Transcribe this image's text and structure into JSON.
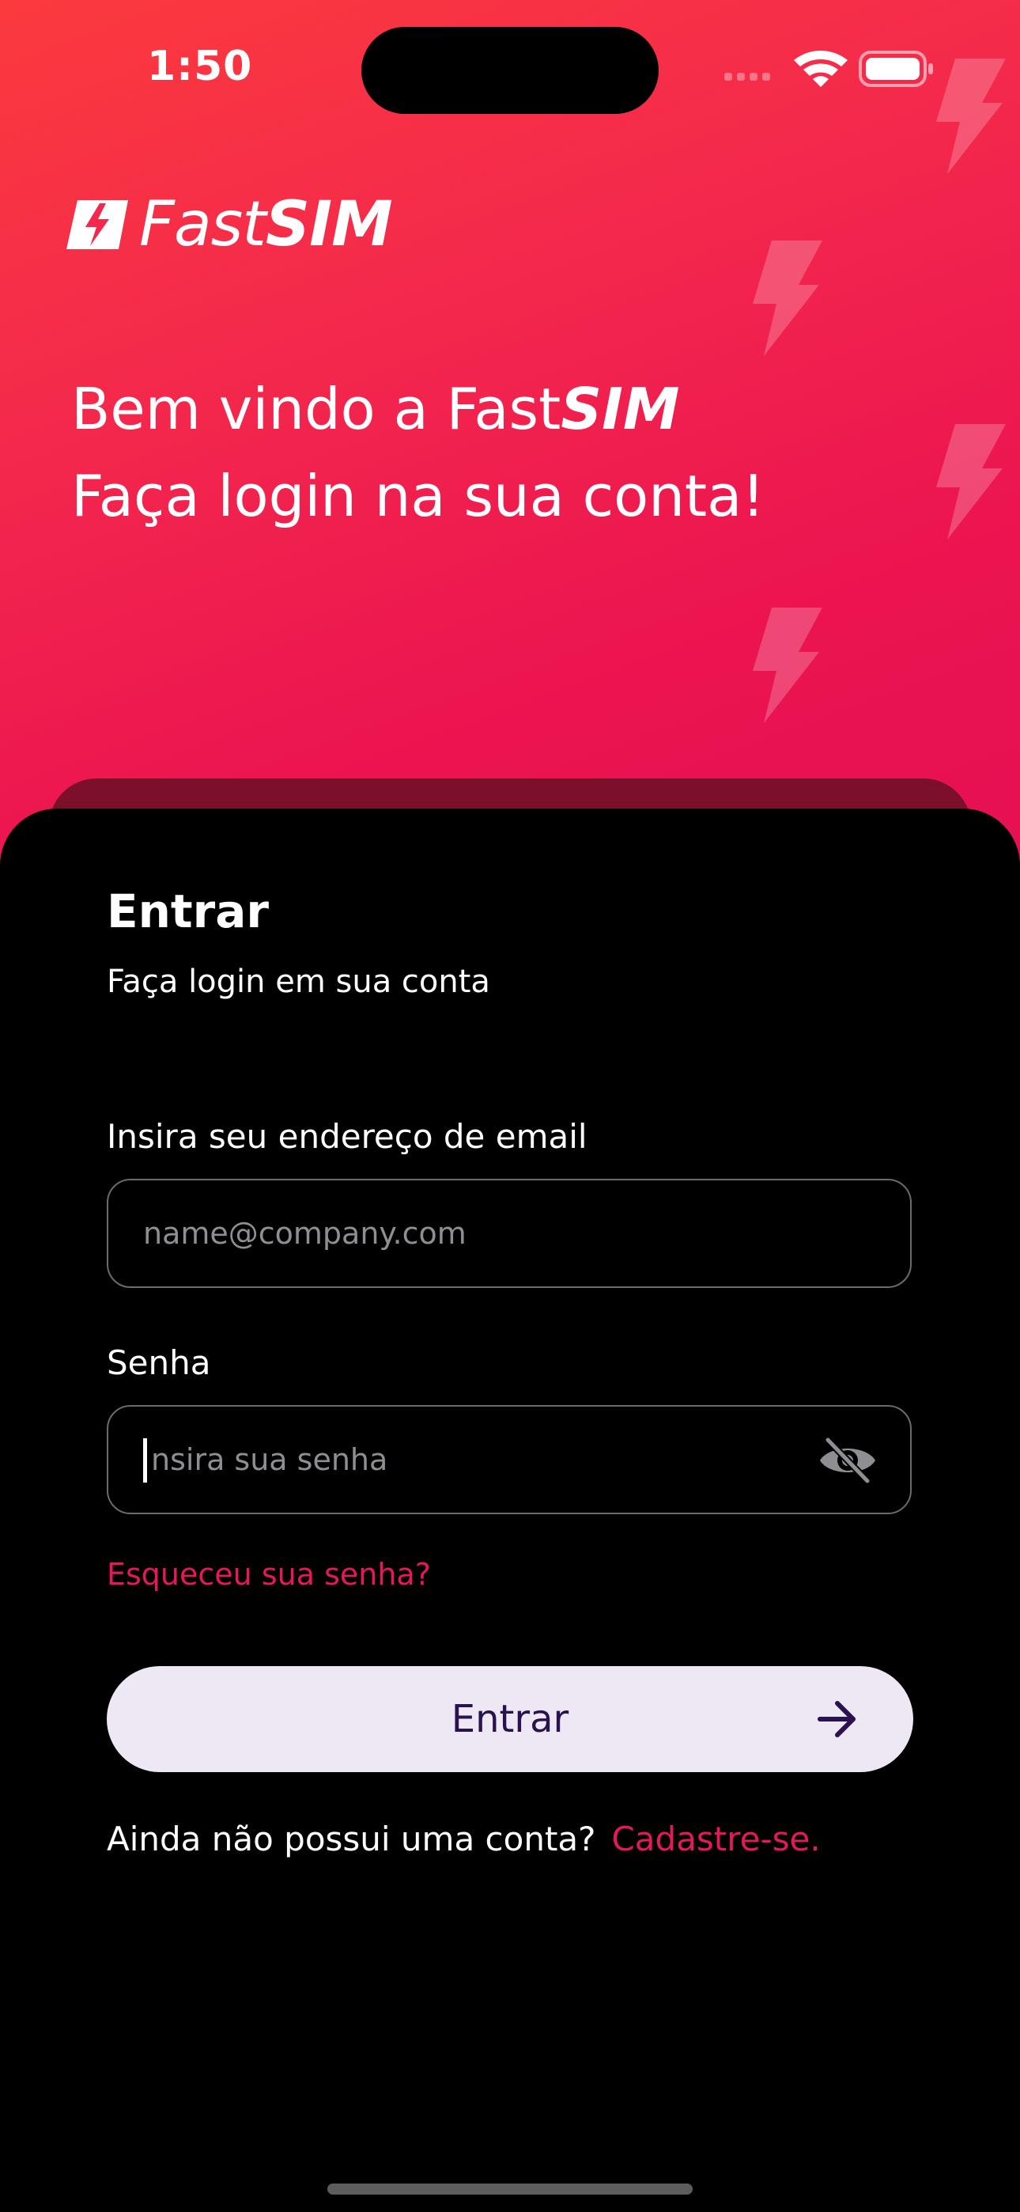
{
  "status_bar": {
    "time": "1:50"
  },
  "logo": {
    "part1": "Fast",
    "part2": "SIM"
  },
  "welcome": {
    "line1_prefix": "Bem vindo a ",
    "brand_part1": "Fast",
    "brand_part2": "SIM",
    "line2": "Faça login na sua conta!"
  },
  "login": {
    "title": "Entrar",
    "subtitle": "Faça login em sua conta",
    "email_label": "Insira seu endereço de email",
    "email_placeholder": "name@company.com",
    "email_value": "",
    "password_label": "Senha",
    "password_placeholder": "nsira sua senha",
    "password_value": "",
    "forgot_link": "Esqueceu sua senha?",
    "submit_label": "Entrar",
    "signup_prompt": "Ainda não possui uma conta?",
    "signup_link": "Cadastre-se."
  },
  "colors": {
    "accent": "#e5195a",
    "button_bg": "#eee8f4",
    "button_text": "#2a1150",
    "hero_gradient_start": "#fb3a3e",
    "hero_gradient_end": "#e50f52"
  },
  "icons": {
    "wifi": "wifi-icon",
    "battery": "battery-icon",
    "cellular": "cellular-icon",
    "password_toggle": "eye-slash-icon",
    "submit": "arrow-right-icon",
    "background": "lightning-bolt-icon"
  }
}
